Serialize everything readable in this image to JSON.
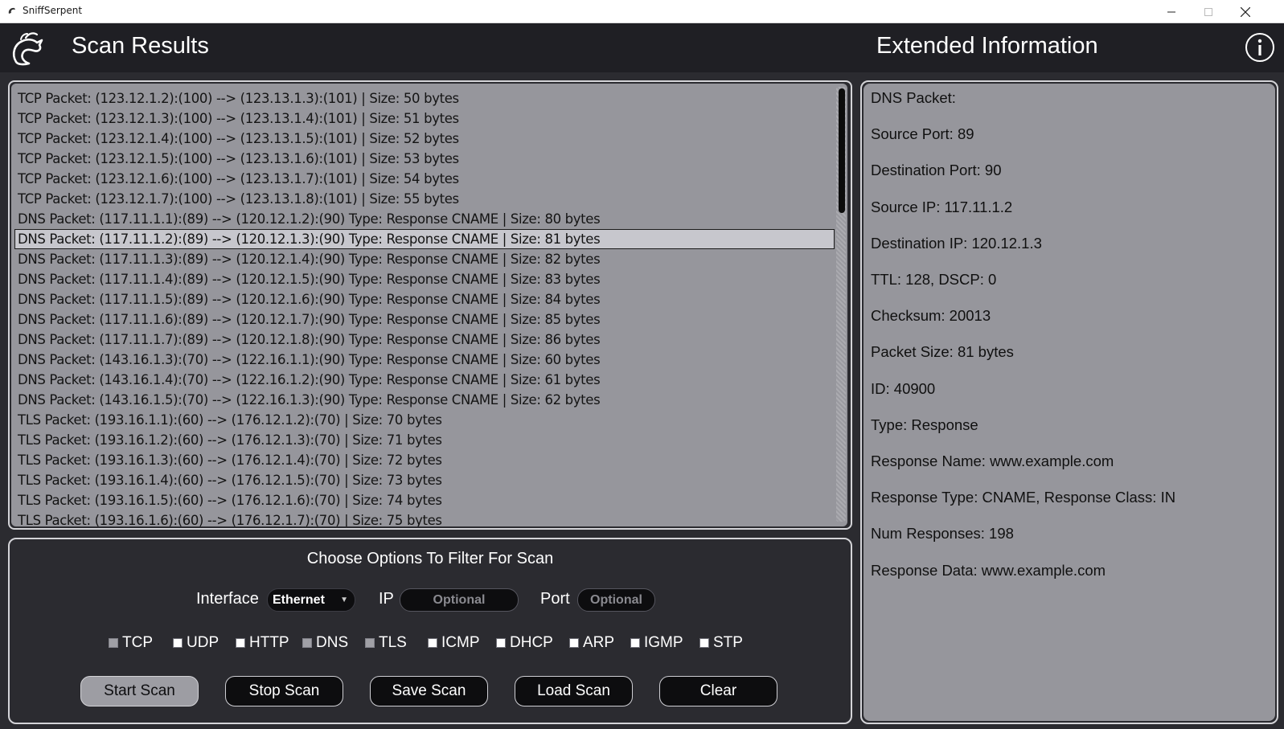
{
  "window": {
    "title": "SniffSerpent"
  },
  "header": {
    "scan_title": "Scan Results",
    "extended_title": "Extended Information"
  },
  "packets": [
    "TCP Packet: (123.12.1.2):(100) --> (123.13.1.3):(101) | Size: 50 bytes",
    "TCP Packet: (123.12.1.3):(100) --> (123.13.1.4):(101) | Size: 51 bytes",
    "TCP Packet: (123.12.1.4):(100) --> (123.13.1.5):(101) | Size: 52 bytes",
    "TCP Packet: (123.12.1.5):(100) --> (123.13.1.6):(101) | Size: 53 bytes",
    "TCP Packet: (123.12.1.6):(100) --> (123.13.1.7):(101) | Size: 54 bytes",
    "TCP Packet: (123.12.1.7):(100) --> (123.13.1.8):(101) | Size: 55 bytes",
    "DNS Packet: (117.11.1.1):(89) --> (120.12.1.2):(90) Type: Response CNAME | Size: 80 bytes",
    "DNS Packet: (117.11.1.2):(89) --> (120.12.1.3):(90) Type: Response CNAME | Size: 81 bytes",
    "DNS Packet: (117.11.1.3):(89) --> (120.12.1.4):(90) Type: Response CNAME | Size: 82 bytes",
    "DNS Packet: (117.11.1.4):(89) --> (120.12.1.5):(90) Type: Response CNAME | Size: 83 bytes",
    "DNS Packet: (117.11.1.5):(89) --> (120.12.1.6):(90) Type: Response CNAME | Size: 84 bytes",
    "DNS Packet: (117.11.1.6):(89) --> (120.12.1.7):(90) Type: Response CNAME | Size: 85 bytes",
    "DNS Packet: (117.11.1.7):(89) --> (120.12.1.8):(90) Type: Response CNAME | Size: 86 bytes",
    "DNS Packet: (143.16.1.3):(70) --> (122.16.1.1):(90) Type: Response CNAME | Size: 60 bytes",
    "DNS Packet: (143.16.1.4):(70) --> (122.16.1.2):(90) Type: Response CNAME | Size: 61 bytes",
    "DNS Packet: (143.16.1.5):(70) --> (122.16.1.3):(90) Type: Response CNAME | Size: 62 bytes",
    "TLS Packet: (193.16.1.1):(60) --> (176.12.1.2):(70) | Size: 70 bytes",
    "TLS Packet: (193.16.1.2):(60) --> (176.12.1.3):(70) | Size: 71 bytes",
    "TLS Packet: (193.16.1.3):(60) --> (176.12.1.4):(70) | Size: 72 bytes",
    "TLS Packet: (193.16.1.4):(60) --> (176.12.1.5):(70) | Size: 73 bytes",
    "TLS Packet: (193.16.1.5):(60) --> (176.12.1.6):(70) | Size: 74 bytes",
    "TLS Packet: (193.16.1.6):(60) --> (176.12.1.7):(70) | Size: 75 bytes"
  ],
  "selected_packet_index": 7,
  "filter": {
    "title": "Choose Options To Filter For Scan",
    "interface_label": "Interface",
    "interface_value": "Ethernet",
    "ip_label": "IP",
    "ip_placeholder": "Optional",
    "port_label": "Port",
    "port_placeholder": "Optional",
    "protocols": [
      {
        "label": "TCP",
        "checked": true
      },
      {
        "label": "UDP",
        "checked": false
      },
      {
        "label": "HTTP",
        "checked": false
      },
      {
        "label": "DNS",
        "checked": true
      },
      {
        "label": "TLS",
        "checked": true
      },
      {
        "label": "ICMP",
        "checked": false
      },
      {
        "label": "DHCP",
        "checked": false
      },
      {
        "label": "ARP",
        "checked": false
      },
      {
        "label": "IGMP",
        "checked": false
      },
      {
        "label": "STP",
        "checked": false
      }
    ]
  },
  "buttons": {
    "start": "Start Scan",
    "stop": "Stop Scan",
    "save": "Save Scan",
    "load": "Load Scan",
    "clear": "Clear"
  },
  "extended_info": [
    "DNS Packet:",
    "Source Port: 89",
    "Destination Port: 90",
    "Source IP: 117.11.1.2",
    "Destination IP: 120.12.1.3",
    "TTL: 128, DSCP: 0",
    "Checksum: 20013",
    "Packet Size: 81 bytes",
    "ID: 40900",
    "Type: Response",
    "Response Name: www.example.com",
    "Response Type: CNAME, Response Class: IN",
    "Num Responses: 198",
    "Response Data: www.example.com"
  ],
  "icons": {
    "app": "serpent-logo-icon",
    "info": "info-icon",
    "minimize": "minimize-icon",
    "maximize": "maximize-icon",
    "close": "close-icon"
  },
  "colors": {
    "header_bg": "#1f1f24",
    "panel_bg": "#96969c",
    "dark_bg": "#2b2b30",
    "input_bg": "#0d0d0f"
  }
}
